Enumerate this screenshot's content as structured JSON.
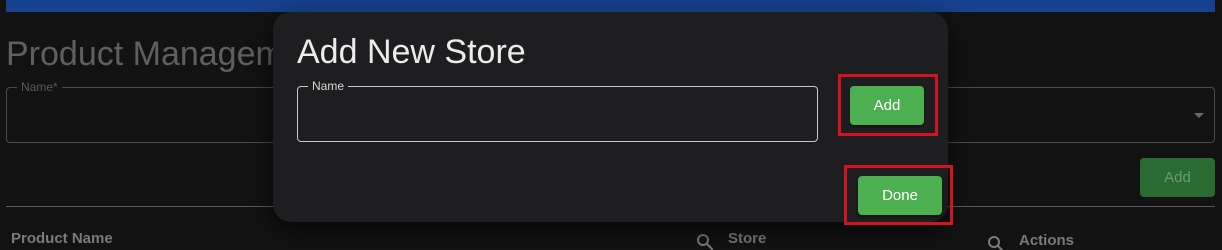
{
  "background": {
    "page_title": "Product Management",
    "name_field": {
      "legend": "Name*"
    },
    "add_button": {
      "label": "Add"
    },
    "table": {
      "columns": [
        {
          "label": "Product Name"
        },
        {
          "label": "Store",
          "icon": "search-icon"
        },
        {
          "label": "Actions",
          "icon": "search-icon"
        }
      ]
    }
  },
  "modal": {
    "title": "Add New Store",
    "name_field": {
      "legend": "Name",
      "value": "",
      "placeholder": ""
    },
    "add_label": "Add",
    "done_label": "Done"
  },
  "colors": {
    "top_bar": "#16418e",
    "primary_button": "#4caf50",
    "highlight": "#d3141f",
    "modal_background": "#1e1e20",
    "page_background": "#121212"
  }
}
